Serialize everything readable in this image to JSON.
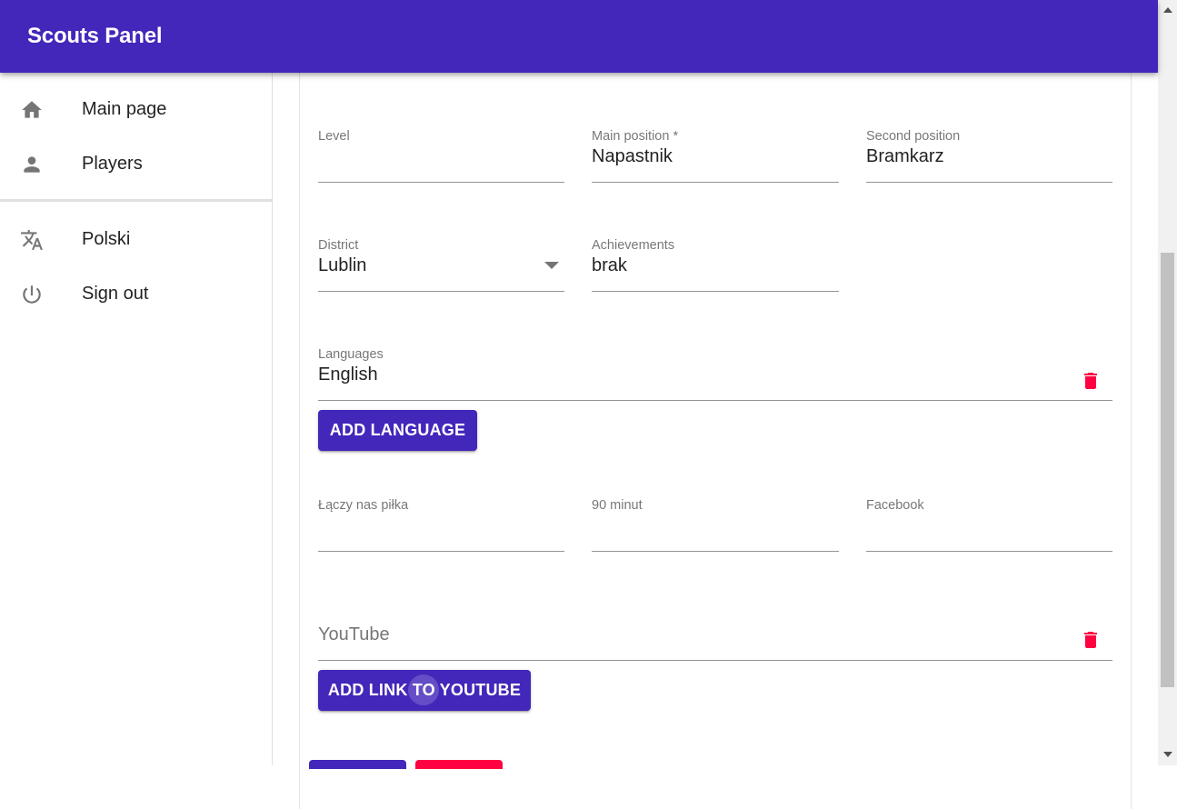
{
  "app": {
    "title": "Scouts Panel"
  },
  "nav": {
    "items": [
      {
        "label": "Main page",
        "icon": "home-icon"
      },
      {
        "label": "Players",
        "icon": "person-icon"
      },
      {
        "label": "Polski",
        "icon": "translate-icon"
      },
      {
        "label": "Sign out",
        "icon": "power-icon"
      }
    ]
  },
  "form": {
    "level": {
      "label": "Level",
      "value": ""
    },
    "main_position": {
      "label": "Main position *",
      "value": "Napastnik"
    },
    "second_position": {
      "label": "Second position",
      "value": "Bramkarz"
    },
    "district": {
      "label": "District",
      "value": "Lublin"
    },
    "achievements": {
      "label": "Achievements",
      "value": "brak"
    },
    "languages": {
      "label": "Languages",
      "value": "English"
    },
    "add_language": "ADD LANGUAGE",
    "laczy_nas_pilka": {
      "label": "Łączy nas piłka",
      "value": ""
    },
    "minut90": {
      "label": "90 minut",
      "value": ""
    },
    "facebook": {
      "label": "Facebook",
      "value": ""
    },
    "youtube": {
      "placeholder": "YouTube"
    },
    "add_youtube": "ADD LINK TO YOUTUBE"
  },
  "colors": {
    "primary": "#4326ba",
    "danger": "#ff0040"
  }
}
